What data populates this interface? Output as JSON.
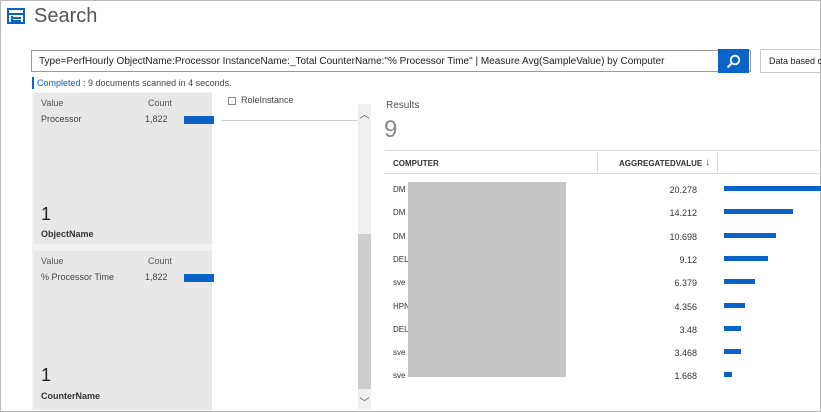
{
  "header": {
    "title": "Search",
    "icon": "search-list-icon"
  },
  "query": {
    "value": "Type=PerfHourly  ObjectName:Processor  InstanceName:_Total  CounterName:\"% Processor Time\" | Measure Avg(SampleValue) by Computer",
    "clear": "✕",
    "search_icon": "magnifier-icon"
  },
  "data_based": "Data based c",
  "status": {
    "done": "Completed",
    "rest": " : 9 documents scanned in 4 seconds."
  },
  "facets": [
    {
      "value_label": "Value",
      "count_label": "Count",
      "row": {
        "name": "Processor",
        "count": "1,822",
        "fill": 1.0
      },
      "big": "1",
      "field": "ObjectName"
    },
    {
      "value_label": "Value",
      "count_label": "Count",
      "row": {
        "name": "% Processor Time",
        "count": "1,822",
        "fill": 1.0
      },
      "big": "1",
      "field": "CounterName"
    }
  ],
  "middle": {
    "role_label": "RoleInstance"
  },
  "results": {
    "title": "Results",
    "count": "9",
    "columns": {
      "computer": "COMPUTER",
      "aggregated": "AGGREGATEDVALUE",
      "sort": "↓"
    },
    "max": 20.278,
    "rows": [
      {
        "computer": "DM",
        "value": "20.278",
        "num": 20.278
      },
      {
        "computer": "DM",
        "value": "14.212",
        "num": 14.212
      },
      {
        "computer": "DM",
        "value": "10.698",
        "num": 10.698
      },
      {
        "computer": "DEL",
        "value": "9.12",
        "num": 9.12
      },
      {
        "computer": "sve",
        "value": "6.379",
        "num": 6.379
      },
      {
        "computer": "HPN",
        "value": "4.356",
        "num": 4.356
      },
      {
        "computer": "DEL",
        "value": "3.48",
        "num": 3.48
      },
      {
        "computer": "sve",
        "value": "3.468",
        "num": 3.468
      },
      {
        "computer": "sve",
        "value": "1.668",
        "num": 1.668
      }
    ]
  },
  "colors": {
    "accent": "#0a63c6",
    "redaction": "#c6c6c6"
  }
}
